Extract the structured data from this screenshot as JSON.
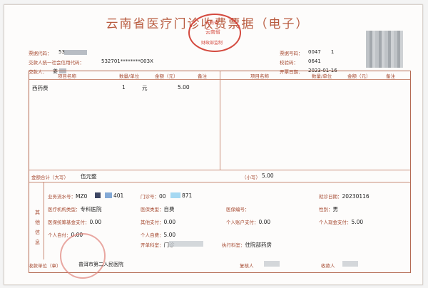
{
  "title": "云南省医疗门诊收费票据（电子）",
  "header": {
    "bill_code_label": "票据代码：",
    "bill_code_value": "53     ",
    "payer_credit_label": "交款人统一社会信用代码：",
    "payer_credit_value": "532701********003X",
    "payer_label": "交款人：",
    "payer_value": "姜",
    "bill_no_label": "票据号码：",
    "bill_no_value": "0047    1",
    "check_code_label": "校验码：",
    "check_code_value": "0641",
    "issue_date_label": "开票日期：",
    "issue_date_value": "2023-01-16"
  },
  "table": {
    "headers": [
      "项目名称",
      "数量/单位",
      "金额（元）",
      "备注",
      "项目名称",
      "数量/单位",
      "金额（元）",
      "备注"
    ],
    "rows": [
      {
        "name": "西药费",
        "qty": "1",
        "unit": "元",
        "amount": "5.00"
      }
    ],
    "total_words_label": "金额合计（大写）",
    "total_words_value": "伍元整",
    "total_num_label": "（小写）",
    "total_num_value": "5.00"
  },
  "other": {
    "side_label_1": "其",
    "side_label_2": "他",
    "side_label_3": "信",
    "side_label_4": "息",
    "serial_label": "业务流水号：",
    "serial_value_a": "MZ0",
    "serial_value_b": "401",
    "clinic_no_label": "门诊号：",
    "clinic_no_value_a": "00",
    "clinic_no_value_b": "871",
    "visit_date_label": "就诊日期：",
    "visit_date_value": "20230116",
    "org_type_label": "医疗机构类型：",
    "org_type_value": "专科医院",
    "ins_type_label": "医保类型：",
    "ins_type_value": "自费",
    "ins_no_label": "医保编号：",
    "ins_no_value": "",
    "gender_label": "性别：",
    "gender_value": "男",
    "pool_pay_label": "医保统筹基金支付：",
    "pool_pay_value": "0.00",
    "other_pay_label": "其他支付：",
    "other_pay_value": "0.00",
    "personal_acct_label": "个人账户支付：",
    "personal_acct_value": "0.00",
    "personal_cash_label": "个人现金支付：",
    "personal_cash_value": "5.00",
    "self_pay_label": "个人自付：",
    "self_pay_value": "0.00",
    "self_fee_label": "个人自费：",
    "self_fee_value": "5.00",
    "dept_label": "开单科室：",
    "dept_value": "门诊",
    "exec_dept_label": "执行科室：",
    "exec_dept_value": "住院部药房"
  },
  "footer": {
    "payee_label": "收款单位（章）",
    "payee_value": "普洱市第二人民医院",
    "reviewer_label": "复核人",
    "payee_person_label": "收款人"
  },
  "stamp": {
    "top_text": "云南省",
    "bottom_text": "财政部监制",
    "center_text": "云南省"
  }
}
